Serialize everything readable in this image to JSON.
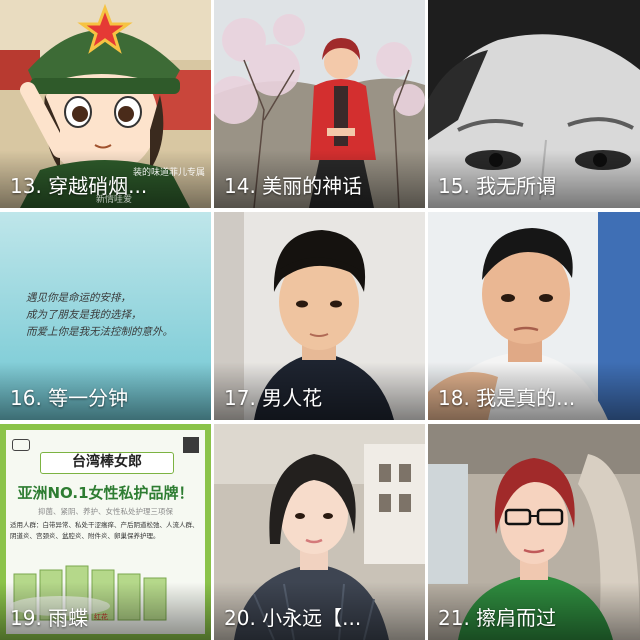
{
  "gallery": {
    "tiles": [
      {
        "caption": "13. 穿越硝烟...",
        "icon": "cartoon-soldier-avatar",
        "notes": [
          "装的味道菲儿专属",
          "新情哇爱"
        ]
      },
      {
        "caption": "14. 美丽的神话",
        "icon": "woman-red-coat-photo"
      },
      {
        "caption": "15. 我无所谓",
        "icon": "closeup-face-grayscale-photo"
      },
      {
        "caption": "16. 等一分钟",
        "icon": "handwriting-quote-card",
        "handwriting": [
          "遇见你是命运的安排，",
          "成为了朋友是我的选择，",
          "而爱上你是我无法控制的意外。"
        ]
      },
      {
        "caption": "17. 男人花",
        "icon": "young-man-portrait-photo"
      },
      {
        "caption": "18. 我是真的...",
        "icon": "man-selfie-photo"
      },
      {
        "caption": "19. 雨蝶",
        "icon": "product-advertisement",
        "ad": {
          "title": "台湾棒女郎",
          "slogan": "亚洲NO.1女性私护品牌！",
          "subtitle": "抑菌、紧阴、养护、女性私处护理三项保",
          "body": "适用人群：白带异常、私处干涩瘙痒、产后阴道松弛、人流人群、阴道炎、宫颈炎、盆腔炎、附件炎、卵巢保养护理。",
          "brand": "红花"
        }
      },
      {
        "caption": "20. 小永远【...",
        "icon": "woman-short-hair-photo"
      },
      {
        "caption": "21. 擦肩而过",
        "icon": "woman-glasses-car-photo"
      }
    ]
  },
  "colors": {
    "caption_text": "#ffffff",
    "ad_green": "#8bc34a",
    "quote_bg": "#8fd3dc"
  }
}
